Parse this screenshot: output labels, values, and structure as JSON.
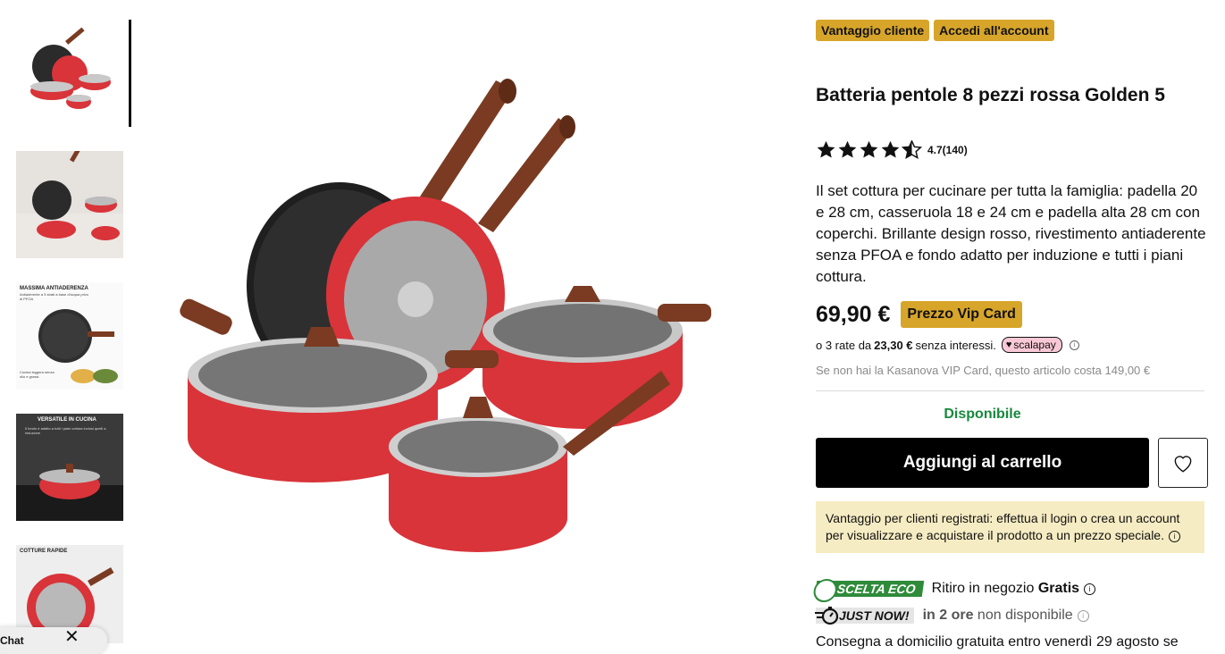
{
  "thumbnails": [
    {
      "caption": "",
      "sub": ""
    },
    {
      "caption": "",
      "sub": ""
    },
    {
      "caption": "MASSIMA ANTIADERENZA",
      "sub": "Antiaderente a 3 strati a base d'acqua privo di PFOA"
    },
    {
      "caption": "VERSATILE IN CUCINA",
      "sub": "Il fondo è adatto a tutti i piani cottura inclusi quelli a induzione"
    },
    {
      "caption": "COTTURE RAPIDE",
      "sub": ""
    }
  ],
  "thumbnail_extra_text": "Cucina leggera senza olio e grassi",
  "header_badges": {
    "customer_advantage": "Vantaggio cliente",
    "login": "Accedi all'account"
  },
  "product": {
    "title": "Batteria pentole 8 pezzi rossa Golden 5",
    "rating_value": 4.7,
    "rating_text": "4.7(140)",
    "description": "Il set cottura per cucinare per tutta la famiglia: padella 20 e 28 cm, casseruola 18 e 24 cm e padella alta 28 cm con coperchi. Brillante design rosso, rivestimento antiaderente senza PFOA e fondo adatto per induzione e tutti i piani cottura.",
    "price": "69,90 €",
    "vip_badge": "Prezzo Vip Card",
    "installments_prefix": "o 3 rate da",
    "installment_amount": "23,30 €",
    "installments_suffix": "senza interessi.",
    "scalapay_label": "scalapay",
    "vip_note": "Se non hai la Kasanova VIP Card, questo articolo costa 149,00 €",
    "availability": "Disponibile"
  },
  "actions": {
    "add_to_cart": "Aggiungi al carrello"
  },
  "notice": {
    "text": "Vantaggio per clienti registrati: effettua il login o crea un account per visualizzare e acquistare il prodotto a un prezzo speciale."
  },
  "delivery": {
    "eco_badge": "SCELTA ECO",
    "pickup_prefix": "Ritiro in negozio",
    "pickup_bold": "Gratis",
    "just_now_badge": "JUST NOW!",
    "in_2h_bold": "in 2 ore",
    "in_2h_suffix": "non disponibile",
    "cut_line": "Consegna a domicilio gratuita entro venerdì 29 agosto se"
  },
  "chat": {
    "label": "Chat"
  },
  "colors": {
    "accent_gold": "#d7a52a",
    "available_green": "#168a3c",
    "notice_bg": "#f6ecc3",
    "pan_red": "#d8343a"
  }
}
